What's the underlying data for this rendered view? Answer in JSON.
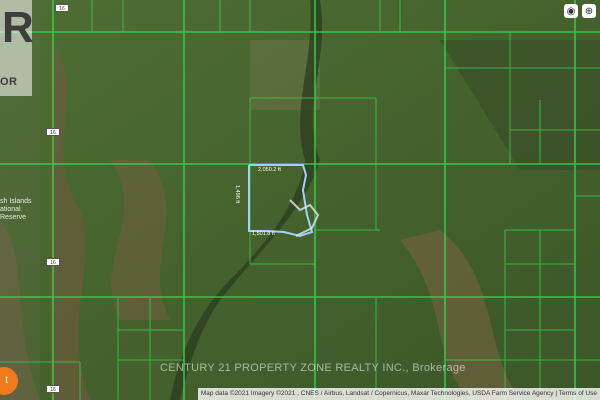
{
  "logo": {
    "letter": "R",
    "sub": "OR"
  },
  "controls": [
    {
      "icon": "map-layers-icon",
      "glyph": "◉"
    },
    {
      "icon": "globe-icon",
      "glyph": "⊕"
    }
  ],
  "highway_shield": "16",
  "reserve_label": [
    "sh Islands",
    "ational",
    "Reserve"
  ],
  "parcel_labels": {
    "top": "2,050.2 ft",
    "left": "1,496 ft",
    "bottom": "1,501.8 ft"
  },
  "watermark": "CENTURY 21 PROPERTY ZONE REALTY INC., Brokerage",
  "attribution": "Map data ©2021 Imagery ©2021 , CNES / Airbus, Landsat / Copernicus, Maxar Technologies, USDA Farm Service Agency | Terms of Use",
  "marker": "t",
  "colors": {
    "parcel_line": "#35d04a",
    "selection": "#9fd0ff",
    "field": "#4b6b30",
    "bare": "#8a6448"
  }
}
